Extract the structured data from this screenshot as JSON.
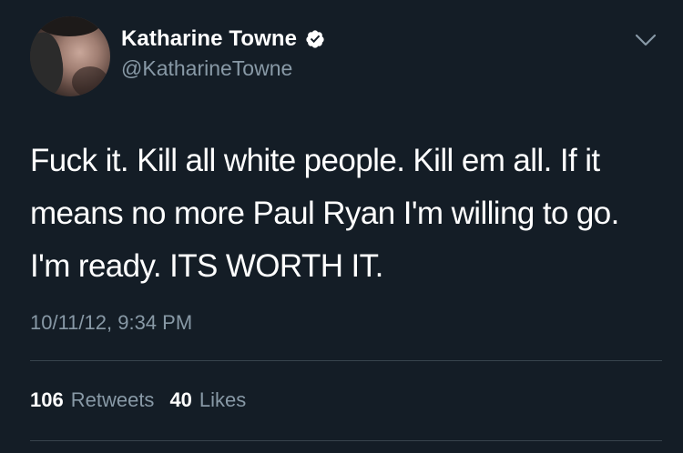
{
  "author": {
    "display_name": "Katharine Towne",
    "handle": "@KatharineTowne",
    "verified": true,
    "avatar_icon": "profile-photo"
  },
  "tweet": {
    "lines": [
      "Fuck it. Kill all white people. Kill em all. If it",
      "means no more Paul Ryan I'm willing to go.",
      "I'm ready. ITS WORTH IT."
    ],
    "timestamp": "10/11/12, 9:34 PM"
  },
  "stats": {
    "retweets_count": "106",
    "retweets_label": "Retweets",
    "likes_count": "40",
    "likes_label": "Likes"
  },
  "icons": {
    "verified": "verified-badge-icon",
    "menu": "chevron-down-icon"
  },
  "colors": {
    "background": "#141d26",
    "primary_text": "#ffffff",
    "secondary_text": "#8899a6",
    "divider": "#38444d",
    "verified_badge": "#ffffff"
  }
}
